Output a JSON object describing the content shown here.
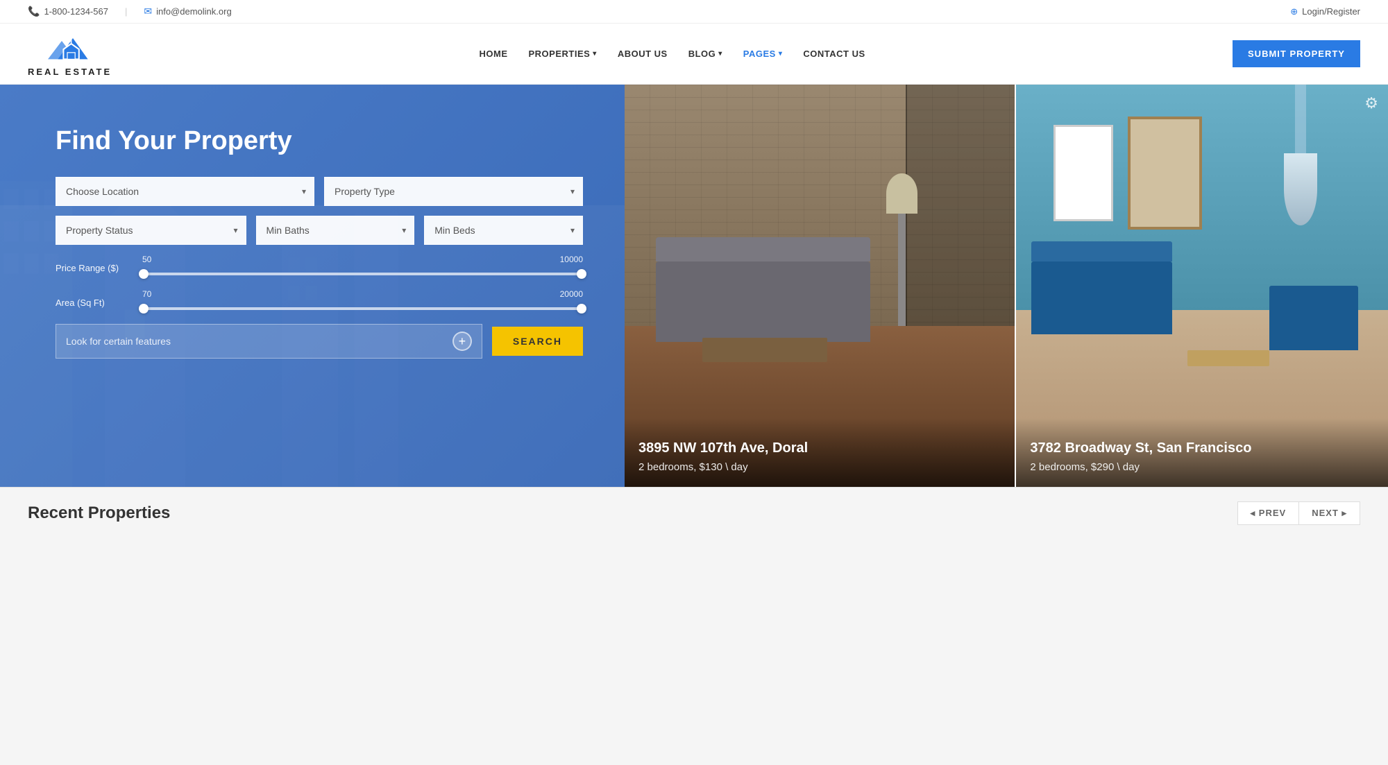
{
  "topbar": {
    "phone_icon": "📞",
    "phone": "1-800-1234-567",
    "email_icon": "✉",
    "email": "info@demolink.org",
    "login_icon": "→",
    "login": "Login/Register",
    "separator": "|"
  },
  "nav": {
    "logo_text": "REAL ESTATE",
    "items": [
      {
        "label": "HOME",
        "id": "home",
        "has_dropdown": false
      },
      {
        "label": "PROPERTIES",
        "id": "properties",
        "has_dropdown": true
      },
      {
        "label": "ABOUT US",
        "id": "about",
        "has_dropdown": false
      },
      {
        "label": "BLOG",
        "id": "blog",
        "has_dropdown": true
      },
      {
        "label": "PAGES",
        "id": "pages",
        "has_dropdown": true
      },
      {
        "label": "CONTACT US",
        "id": "contact",
        "has_dropdown": false
      }
    ],
    "submit_label": "SUBMIT PROPERTY"
  },
  "search": {
    "title": "Find Your Property",
    "location_placeholder": "Choose Location",
    "property_type_placeholder": "Property Type",
    "status_placeholder": "Property Status",
    "min_baths_placeholder": "Min Baths",
    "min_beds_placeholder": "Min Beds",
    "price_label": "Price Range ($)",
    "price_min": "50",
    "price_max": "10000",
    "area_label": "Area (Sq Ft)",
    "area_min": "70",
    "area_max": "20000",
    "features_placeholder": "Look for certain features",
    "search_label": "SEARCH"
  },
  "properties": [
    {
      "id": "prop1",
      "address": "3895 NW 107th Ave, Doral",
      "price": "2 bedrooms, $130 \\ day"
    },
    {
      "id": "prop2",
      "address": "3782 Broadway St, San Francisco",
      "price": "2 bedrooms, $290 \\ day"
    }
  ],
  "recent": {
    "title": "Recent Properties",
    "prev_label": "◂  PREV",
    "next_label": "NEXT  ▸"
  }
}
